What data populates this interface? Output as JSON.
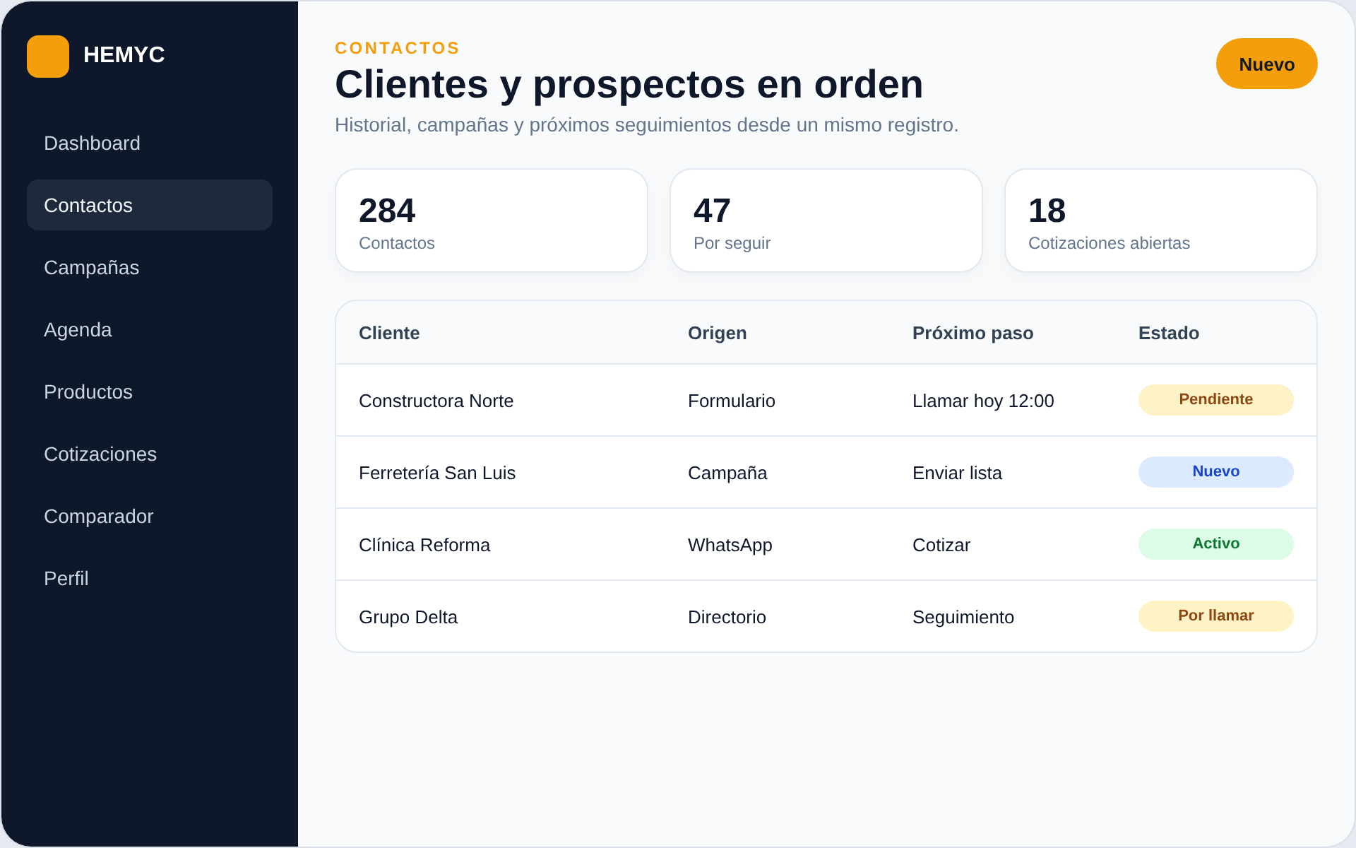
{
  "sidebar": {
    "brand": "HEMYC",
    "items": [
      {
        "label": "Dashboard",
        "selected": false
      },
      {
        "label": "Contactos",
        "selected": true
      },
      {
        "label": "Campañas",
        "selected": false
      },
      {
        "label": "Agenda",
        "selected": false
      },
      {
        "label": "Productos",
        "selected": false
      },
      {
        "label": "Cotizaciones",
        "selected": false
      },
      {
        "label": "Comparador",
        "selected": false
      },
      {
        "label": "Perfil",
        "selected": false
      }
    ]
  },
  "header": {
    "eyebrow": "CONTACTOS",
    "title": "Clientes y prospectos en orden",
    "subtitle": "Historial, campañas y próximos seguimientos desde un mismo registro.",
    "action": "Nuevo"
  },
  "stats": [
    {
      "value": "284",
      "label": "Contactos"
    },
    {
      "value": "47",
      "label": "Por seguir"
    },
    {
      "value": "18",
      "label": "Cotizaciones abiertas"
    }
  ],
  "table": {
    "columns": [
      "Cliente",
      "Origen",
      "Próximo paso",
      "Estado"
    ],
    "rows": [
      {
        "client": "Constructora Norte",
        "origin": "Formulario",
        "next_step": "Llamar hoy 12:00",
        "status": {
          "label": "Pendiente",
          "color": "#fef3c7"
        }
      },
      {
        "client": "Ferretería San Luis",
        "origin": "Campaña",
        "next_step": "Enviar lista",
        "status": {
          "label": "Nuevo",
          "color": "#dbeafe"
        }
      },
      {
        "client": "Clínica Reforma",
        "origin": "WhatsApp",
        "next_step": "Cotizar",
        "status": {
          "label": "Activo",
          "color": "#dcfce7"
        }
      },
      {
        "client": "Grupo Delta",
        "origin": "Directorio",
        "next_step": "Seguimiento",
        "status": {
          "label": "Por llamar",
          "color": "#fef3c7"
        }
      }
    ]
  }
}
